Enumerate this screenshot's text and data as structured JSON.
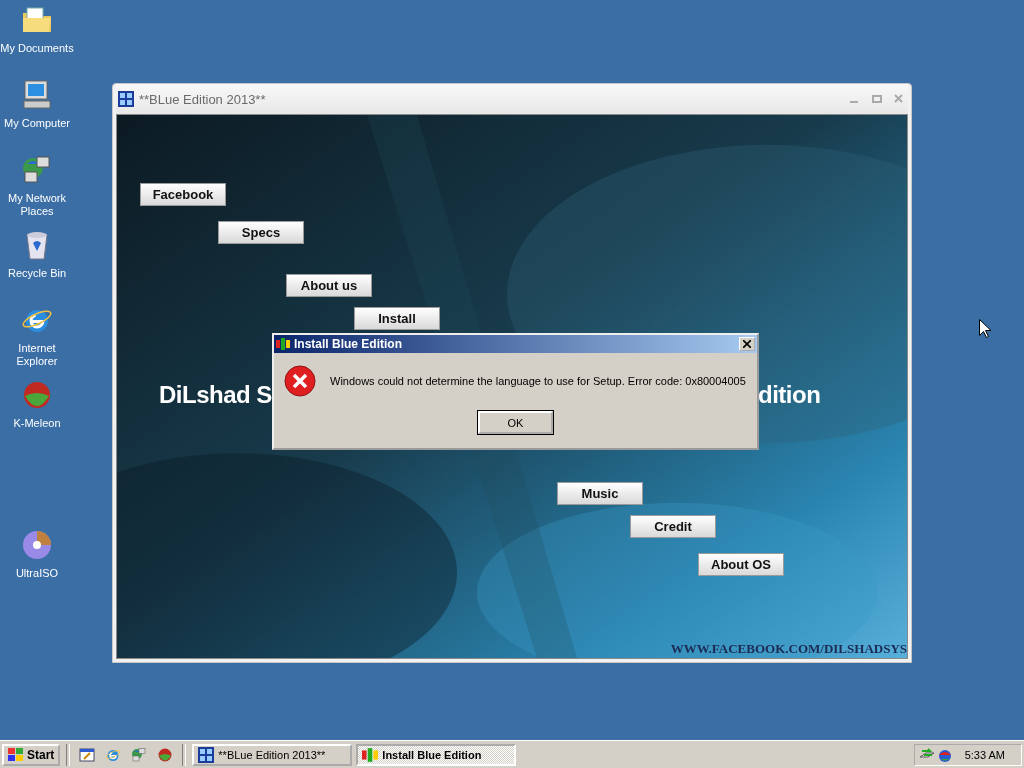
{
  "desktop_icons": [
    {
      "label": "My Documents",
      "kind": "folder"
    },
    {
      "label": "My Computer",
      "kind": "computer"
    },
    {
      "label": "My Network Places",
      "kind": "network"
    },
    {
      "label": "Recycle Bin",
      "kind": "bin"
    },
    {
      "label": "Internet Explorer",
      "kind": "browser"
    },
    {
      "label": "K-Meleon",
      "kind": "meleon"
    },
    {
      "label": "UltraISO",
      "kind": "disc"
    }
  ],
  "app_window": {
    "title": "**BLue Edition 2013**",
    "active": false,
    "buttons": [
      {
        "label": "Facebook"
      },
      {
        "label": "Specs"
      },
      {
        "label": "About us"
      },
      {
        "label": "Install"
      },
      {
        "label": "Music"
      },
      {
        "label": "Credit"
      },
      {
        "label": "About OS"
      }
    ],
    "heading_parts": [
      "DiLshad S",
      "dition"
    ],
    "footer": "WWW.FACEBOOK.COM/DILSHADSYS"
  },
  "dialog": {
    "title": "Install Blue Edition",
    "active": true,
    "message": "Windows could not determine the language to use for Setup. Error code: 0x80004005",
    "button": "OK"
  },
  "taskbar": {
    "start": "Start",
    "quick_launch": [
      {
        "kind": "desktop"
      },
      {
        "kind": "browser"
      },
      {
        "kind": "network"
      },
      {
        "kind": "meleon"
      }
    ],
    "tasks": [
      {
        "label": "**BLue Edition 2013**",
        "selected": false
      },
      {
        "label": "Install Blue Edition",
        "selected": true
      }
    ],
    "clock": "5:33 AM"
  }
}
